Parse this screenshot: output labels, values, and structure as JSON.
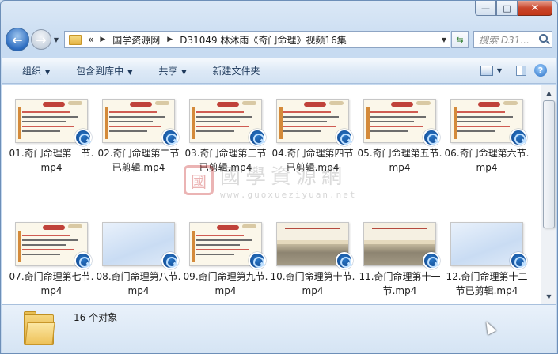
{
  "window": {
    "minimize_icon": "minimize-icon",
    "maximize_icon": "maximize-icon",
    "close_icon": "close-icon",
    "minimize_glyph": "—",
    "maximize_glyph": "□",
    "close_glyph": "✕"
  },
  "nav": {
    "back_glyph": "←",
    "forward_glyph": "→",
    "history_glyph": "▼",
    "breadcrumb_overflow": "«",
    "crumbs": [
      "国学资源网",
      "D31049 林沐雨《奇门命理》视频16集"
    ],
    "crumb_sep": "▶",
    "address_drop": "▼",
    "refresh_glyph": "⇆",
    "search_placeholder": "搜索 D31..."
  },
  "toolbar": {
    "organize": "组织",
    "include_library": "包含到库中",
    "share": "共享",
    "new_folder": "新建文件夹",
    "drop_glyph": "▼",
    "help_glyph": "?"
  },
  "files": [
    {
      "name": "01.奇门命理第一节.mp4",
      "style": "slide"
    },
    {
      "name": "02.奇门命理第二节已剪辑.mp4",
      "style": "slide"
    },
    {
      "name": "03.奇门命理第三节已剪辑.mp4",
      "style": "slide"
    },
    {
      "name": "04.奇门命理第四节已剪辑.mp4",
      "style": "slide"
    },
    {
      "name": "05.奇门命理第五节.mp4",
      "style": "slide"
    },
    {
      "name": "06.奇门命理第六节.mp4",
      "style": "slide"
    },
    {
      "name": "07.奇门命理第七节.mp4",
      "style": "slide"
    },
    {
      "name": "08.奇门命理第八节.mp4",
      "style": "plain"
    },
    {
      "name": "09.奇门命理第九节.mp4",
      "style": "slide"
    },
    {
      "name": "10.奇门命理第十节.mp4",
      "style": "scene"
    },
    {
      "name": "11.奇门命理第十一节.mp4",
      "style": "scene"
    },
    {
      "name": "12.奇门命理第十二节已剪辑.mp4",
      "style": "plain"
    }
  ],
  "watermark": {
    "seal": "國",
    "title": "國學資源網",
    "url": "www.guoxueziyuan.net"
  },
  "status": {
    "item_count": "16 个对象"
  },
  "scroll": {
    "up_glyph": "▲",
    "down_glyph": "▼"
  }
}
